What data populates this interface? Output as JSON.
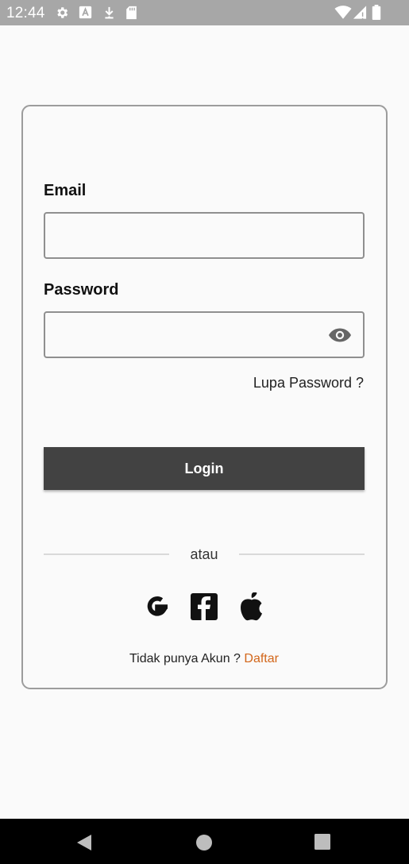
{
  "status_bar": {
    "time": "12:44",
    "left_icons": [
      "settings-icon",
      "a-icon",
      "download-icon",
      "sd-card-icon"
    ],
    "right_icons": [
      "wifi-icon",
      "signal-icon",
      "battery-icon"
    ]
  },
  "login_form": {
    "email_label": "Email",
    "email_value": "",
    "password_label": "Password",
    "password_value": "",
    "forgot_password": "Lupa Password ?",
    "login_button": "Login",
    "divider_text": "atau",
    "social_logins": [
      "google-icon",
      "facebook-icon",
      "apple-icon"
    ],
    "signup_prompt": "Tidak punya Akun ?",
    "signup_link": "Daftar"
  },
  "colors": {
    "status_bar": "#a7a7a7",
    "button": "#424242",
    "link": "#d2661a",
    "card_border": "#9c9c9c"
  },
  "nav_bar": {
    "icons": [
      "back-icon",
      "home-icon",
      "recents-icon"
    ]
  }
}
